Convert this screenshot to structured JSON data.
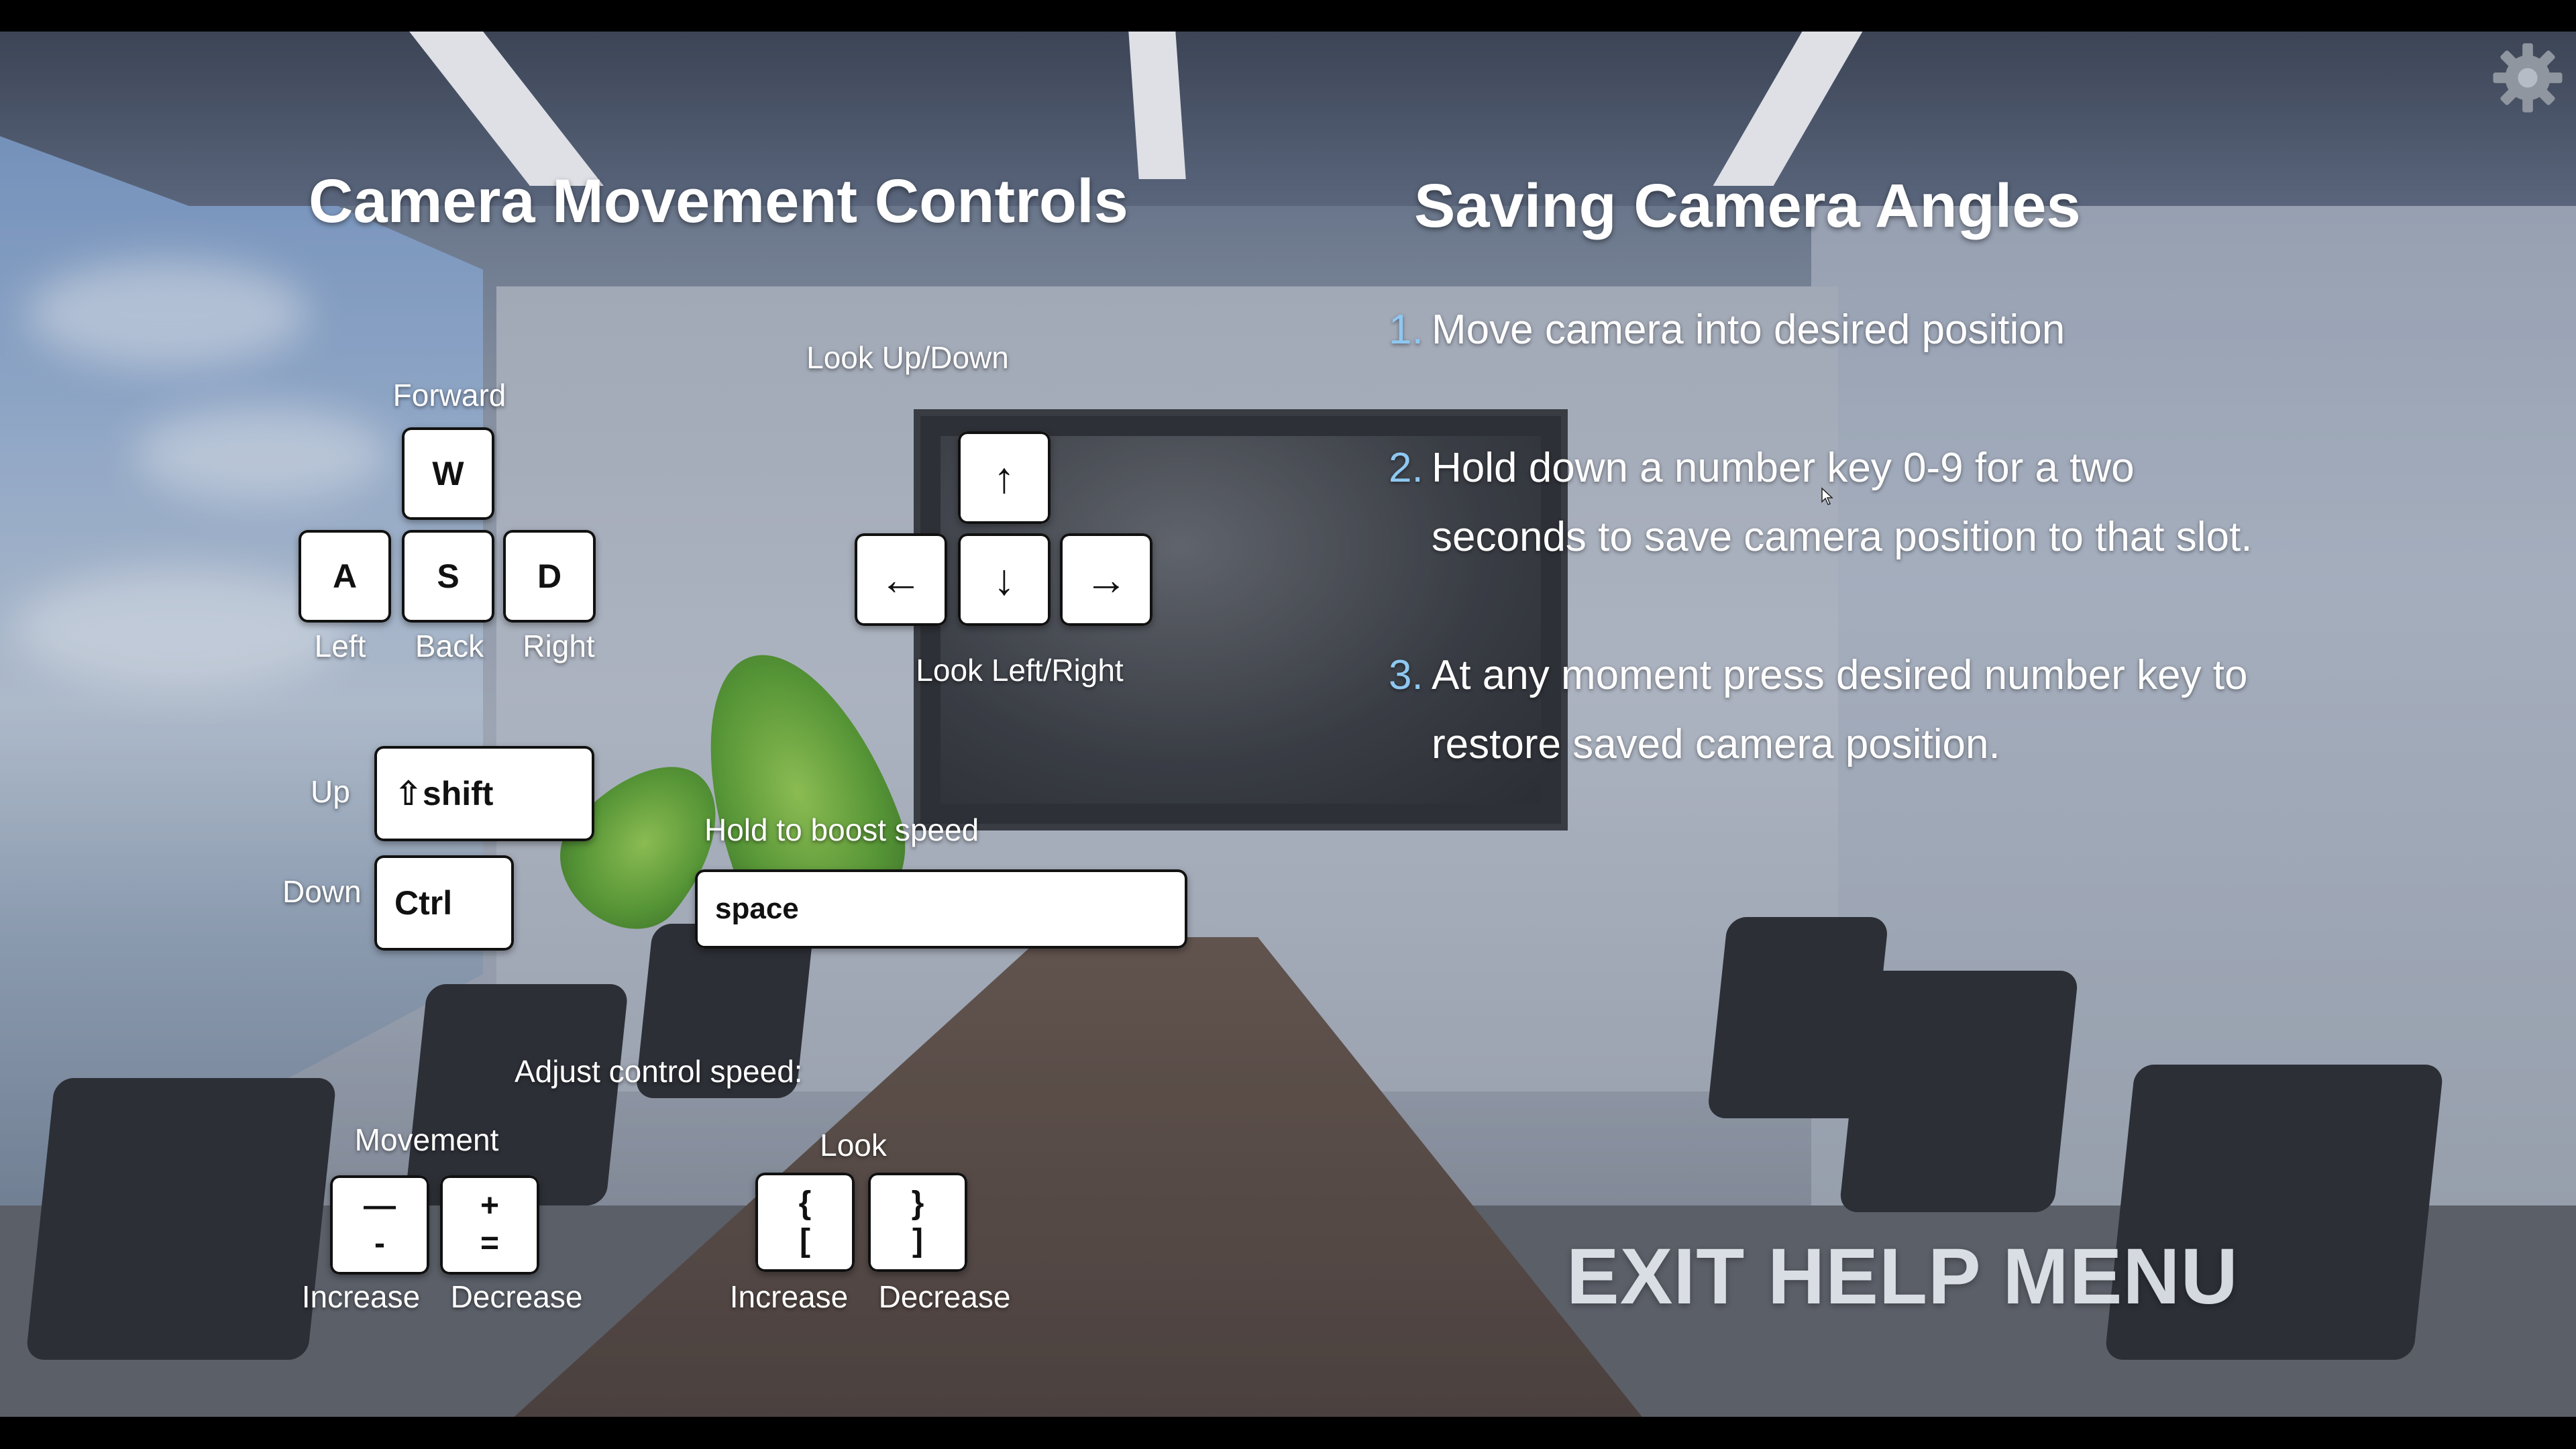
{
  "camera_controls": {
    "title": "Camera Movement Controls",
    "forward_label": "Forward",
    "left_label": "Left",
    "back_label": "Back",
    "right_label": "Right",
    "key_w": "W",
    "key_a": "A",
    "key_s": "S",
    "key_d": "D",
    "look_updown_label": "Look Up/Down",
    "look_leftright_label": "Look Left/Right",
    "arrow_up": "↑",
    "arrow_down": "↓",
    "arrow_left": "←",
    "arrow_right": "→",
    "up_label": "Up",
    "down_label": "Down",
    "key_shift": "⇧shift",
    "key_ctrl": "Ctrl",
    "boost_label": "Hold to boost speed",
    "key_space": "space",
    "adjust_label": "Adjust control speed:",
    "movement_label": "Movement",
    "look_label": "Look",
    "movement_increase_top": "—",
    "movement_increase_bottom": "-",
    "movement_decrease_top": "+",
    "movement_decrease_bottom": "=",
    "look_increase_top": "{",
    "look_increase_bottom": "[",
    "look_decrease_top": "}",
    "look_decrease_bottom": "]",
    "increase_label": "Increase",
    "decrease_label": "Decrease"
  },
  "saving_angles": {
    "title": "Saving Camera Angles",
    "steps": [
      {
        "num": "1.",
        "text": "Move camera into desired position"
      },
      {
        "num": "2.",
        "text": "Hold down a number key 0-9 for a two seconds to save camera position to that slot."
      },
      {
        "num": "3.",
        "text": "At any moment press desired number key to restore saved camera position."
      }
    ]
  },
  "exit_button": "EXIT HELP MENU",
  "icons": {
    "settings": "gear-icon",
    "cursor": "pointer-cursor-icon"
  },
  "colors": {
    "step_number": "#8ec8f2",
    "key_bg": "#ffffff",
    "heading": "#ffffff"
  }
}
